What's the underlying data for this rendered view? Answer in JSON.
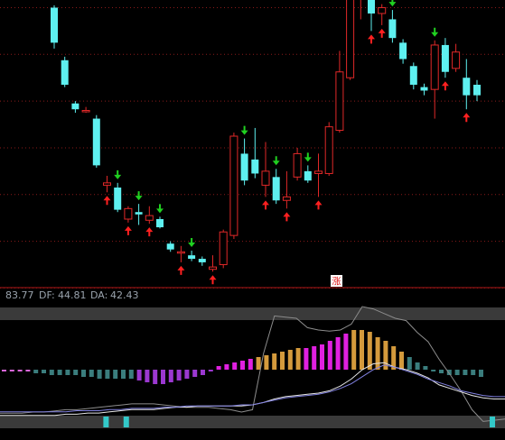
{
  "chart_data": [
    {
      "type": "candlestick",
      "signal_badge": "涨",
      "candles": [
        {
          "o": 31.0,
          "c": 28.0,
          "h": 31.2,
          "l": 27.5,
          "up": false,
          "signal": null
        },
        {
          "o": 26.5,
          "c": 24.4,
          "h": 26.8,
          "l": 24.2,
          "up": false,
          "signal": null
        },
        {
          "o": 22.8,
          "c": 22.3,
          "h": 23.0,
          "l": 22.0,
          "up": false,
          "signal": null
        },
        {
          "o": 22.1,
          "c": 22.2,
          "h": 22.5,
          "l": 22.0,
          "up": true,
          "signal": null
        },
        {
          "o": 21.5,
          "c": 17.5,
          "h": 21.8,
          "l": 17.3,
          "up": false,
          "signal": null
        },
        {
          "o": 15.8,
          "c": 16.0,
          "h": 16.6,
          "l": 15.2,
          "up": true,
          "signal": "buy"
        },
        {
          "o": 15.6,
          "c": 13.7,
          "h": 16.0,
          "l": 13.5,
          "up": false,
          "signal": "sell"
        },
        {
          "o": 13.8,
          "c": 12.9,
          "h": 14.0,
          "l": 12.6,
          "up": true,
          "signal": "buy"
        },
        {
          "o": 13.5,
          "c": 13.3,
          "h": 14.2,
          "l": 12.4,
          "up": false,
          "signal": "sell"
        },
        {
          "o": 13.2,
          "c": 12.8,
          "h": 14.0,
          "l": 12.5,
          "up": true,
          "signal": "buy"
        },
        {
          "o": 12.9,
          "c": 12.2,
          "h": 13.1,
          "l": 12.1,
          "up": false,
          "signal": "sell"
        },
        {
          "o": 10.8,
          "c": 10.3,
          "h": 11.0,
          "l": 10.1,
          "up": false,
          "signal": null
        },
        {
          "o": 10.0,
          "c": 10.1,
          "h": 10.6,
          "l": 9.2,
          "up": true,
          "signal": "buy"
        },
        {
          "o": 9.8,
          "c": 9.5,
          "h": 10.2,
          "l": 9.3,
          "up": false,
          "signal": "sell"
        },
        {
          "o": 9.5,
          "c": 9.2,
          "h": 9.7,
          "l": 8.9,
          "up": false,
          "signal": null
        },
        {
          "o": 8.6,
          "c": 8.8,
          "h": 9.8,
          "l": 8.4,
          "up": true,
          "signal": "buy"
        },
        {
          "o": 9.0,
          "c": 11.8,
          "h": 12.0,
          "l": 8.7,
          "up": true,
          "signal": null
        },
        {
          "o": 11.5,
          "c": 20.0,
          "h": 20.3,
          "l": 11.2,
          "up": true,
          "signal": null
        },
        {
          "o": 18.5,
          "c": 16.2,
          "h": 19.8,
          "l": 15.8,
          "up": false,
          "signal": "sell"
        },
        {
          "o": 16.8,
          "c": 18.0,
          "h": 20.7,
          "l": 16.4,
          "up": false,
          "signal": null
        },
        {
          "o": 17.0,
          "c": 15.8,
          "h": 19.5,
          "l": 14.8,
          "up": true,
          "signal": "buy"
        },
        {
          "o": 16.5,
          "c": 14.5,
          "h": 17.2,
          "l": 14.2,
          "up": false,
          "signal": "sell"
        },
        {
          "o": 14.5,
          "c": 14.8,
          "h": 17.0,
          "l": 13.8,
          "up": true,
          "signal": "buy"
        },
        {
          "o": 16.5,
          "c": 18.5,
          "h": 19.0,
          "l": 16.2,
          "up": true,
          "signal": null
        },
        {
          "o": 17.0,
          "c": 16.2,
          "h": 17.5,
          "l": 16.0,
          "up": false,
          "signal": "sell"
        },
        {
          "o": 16.8,
          "c": 17.0,
          "h": 18.5,
          "l": 14.8,
          "up": true,
          "signal": "buy"
        },
        {
          "o": 16.8,
          "c": 20.8,
          "h": 21.2,
          "l": 16.6,
          "up": true,
          "signal": null
        },
        {
          "o": 20.5,
          "c": 25.5,
          "h": 27.3,
          "l": 20.3,
          "up": true,
          "signal": null
        },
        {
          "o": 25.0,
          "c": 33.5,
          "h": 35.0,
          "l": 24.8,
          "up": true,
          "signal": null
        },
        {
          "o": 33.5,
          "c": 38.0,
          "h": 38.5,
          "l": 30.0,
          "up": true,
          "signal": null
        },
        {
          "o": 37.5,
          "c": 30.5,
          "h": 38.0,
          "l": 29.0,
          "up": false,
          "signal": "buy"
        },
        {
          "o": 31.0,
          "c": 30.5,
          "h": 31.3,
          "l": 29.5,
          "up": true,
          "signal": "buy"
        },
        {
          "o": 30.0,
          "c": 28.4,
          "h": 30.8,
          "l": 28.0,
          "up": false,
          "signal": "sell"
        },
        {
          "o": 28.0,
          "c": 26.6,
          "h": 28.3,
          "l": 26.2,
          "up": false,
          "signal": null
        },
        {
          "o": 26.0,
          "c": 24.4,
          "h": 26.3,
          "l": 24.0,
          "up": false,
          "signal": null
        },
        {
          "o": 24.2,
          "c": 23.9,
          "h": 24.5,
          "l": 23.5,
          "up": false,
          "signal": null
        },
        {
          "o": 24.0,
          "c": 27.8,
          "h": 28.2,
          "l": 21.5,
          "up": true,
          "signal": "sell"
        },
        {
          "o": 27.8,
          "c": 25.5,
          "h": 28.4,
          "l": 25.0,
          "up": false,
          "signal": "buy"
        },
        {
          "o": 25.8,
          "c": 27.2,
          "h": 27.9,
          "l": 25.5,
          "up": true,
          "signal": null
        },
        {
          "o": 25.0,
          "c": 23.5,
          "h": 26.6,
          "l": 22.3,
          "up": false,
          "signal": "buy"
        },
        {
          "o": 23.5,
          "c": 24.4,
          "h": 24.8,
          "l": 23.0,
          "up": false,
          "signal": null
        }
      ]
    },
    {
      "type": "bar",
      "legend": {
        "lead": "83.77",
        "df_label": "DF:",
        "df_value": "44.81",
        "da_label": "DA:",
        "da_value": "42.43"
      },
      "values": [
        -1,
        -1,
        -1,
        -1,
        -2,
        -2,
        -3,
        -3,
        -3,
        -3,
        -4,
        -4,
        -5,
        -5,
        -5,
        -5,
        -5,
        -6,
        -7,
        -8,
        -8,
        -7,
        -6,
        -5,
        -4,
        -3,
        -1,
        2,
        3,
        4,
        5,
        6,
        7,
        8,
        9,
        10,
        11,
        12,
        12,
        13,
        14,
        16,
        18,
        20,
        22,
        22,
        21,
        18,
        16,
        13,
        10,
        7,
        4,
        2,
        -1,
        -2,
        -3,
        -3,
        -3,
        -3,
        -4
      ],
      "colors": [
        "#d966d9",
        "#d966d9",
        "#d966d9",
        "#d966d9",
        "#3a7d7d",
        "#3a7d7d",
        "#3a7d7d",
        "#3a7d7d",
        "#3a7d7d",
        "#3a7d7d",
        "#3a7d7d",
        "#3a7d7d",
        "#3a7d7d",
        "#3a7d7d",
        "#3a7d7d",
        "#3a7d7d",
        "#3a7d7d",
        "#9b38d0",
        "#9b38d0",
        "#9b38d0",
        "#9b38d0",
        "#9b38d0",
        "#9b38d0",
        "#9b38d0",
        "#9b38d0",
        "#9b38d0",
        "#9b38d0",
        "#e020e0",
        "#e020e0",
        "#e020e0",
        "#e020e0",
        "#e020e0",
        "#d49a3c",
        "#d49a3c",
        "#d49a3c",
        "#d49a3c",
        "#d49a3c",
        "#d49a3c",
        "#e020e0",
        "#e020e0",
        "#e020e0",
        "#e020e0",
        "#e020e0",
        "#e020e0",
        "#d49a3c",
        "#d49a3c",
        "#d49a3c",
        "#d49a3c",
        "#d49a3c",
        "#d49a3c",
        "#d49a3c",
        "#3a7d7d",
        "#3a7d7d",
        "#3a7d7d",
        "#3a7d7d",
        "#3a7d7d",
        "#3a7d7d",
        "#3a7d7d",
        "#3a7d7d",
        "#3a7d7d",
        "#3a7d7d"
      ],
      "line_gray": [
        9,
        9,
        9,
        10,
        10,
        11,
        12,
        12,
        13,
        14,
        15,
        16,
        17,
        17,
        17,
        16,
        15,
        14,
        14,
        14,
        13,
        12,
        10,
        12,
        60,
        92,
        91,
        90,
        82,
        80,
        79,
        80,
        85,
        100,
        98,
        94,
        90,
        88,
        78,
        70,
        55,
        42,
        28,
        12,
        2,
        3,
        4
      ],
      "line_white": [
        1,
        1,
        1,
        1,
        1,
        1,
        2,
        2,
        3,
        3,
        4,
        5,
        6,
        6,
        6,
        7,
        8,
        8,
        9,
        9,
        9,
        9,
        9,
        10,
        12,
        15,
        17,
        18,
        19,
        20,
        22,
        26,
        32,
        40,
        45,
        46,
        42,
        40,
        37,
        33,
        27,
        24,
        21,
        18,
        16,
        15,
        15
      ],
      "line_purple": [
        4,
        4,
        4,
        4,
        4,
        4,
        4,
        5,
        5,
        5,
        6,
        6,
        7,
        7,
        7,
        8,
        8,
        9,
        9,
        9,
        9,
        9,
        10,
        10,
        12,
        14,
        16,
        17,
        18,
        19,
        21,
        24,
        28,
        34,
        40,
        44,
        42,
        39,
        36,
        32,
        29,
        26,
        22,
        20,
        18,
        17,
        17
      ],
      "bottom_markers": [
        0.21,
        0.25,
        0.975
      ]
    }
  ]
}
